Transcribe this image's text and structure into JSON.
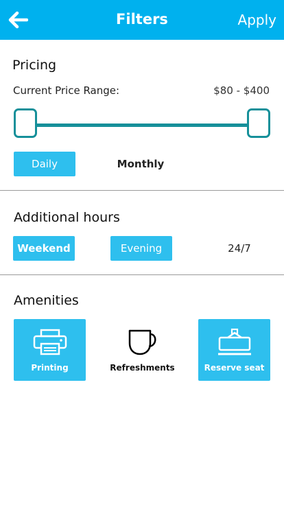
{
  "header": {
    "title": "Filters",
    "apply_label": "Apply"
  },
  "pricing": {
    "title": "Pricing",
    "range_label": "Current Price Range:",
    "range_value": "$80 - $400",
    "slider": {
      "low_fraction": 0.0,
      "high_fraction": 1.0
    },
    "periods": [
      {
        "label": "Daily",
        "selected": true
      },
      {
        "label": "Monthly",
        "selected": false
      }
    ]
  },
  "additional_hours": {
    "title": "Additional hours",
    "options": [
      {
        "label": "Weekend",
        "selected": true
      },
      {
        "label": "Evening",
        "selected": true
      },
      {
        "label": "24/7",
        "selected": false
      }
    ]
  },
  "amenities": {
    "title": "Amenities",
    "items": [
      {
        "label": "Printing",
        "icon": "printer-icon",
        "selected": true
      },
      {
        "label": "Refreshments",
        "icon": "cup-icon",
        "selected": false
      },
      {
        "label": "Reserve seat",
        "icon": "reserve-sign-icon",
        "selected": true
      }
    ]
  },
  "colors": {
    "header": "#00b1ee",
    "chip": "#2ebfee",
    "slider": "#16909a"
  }
}
